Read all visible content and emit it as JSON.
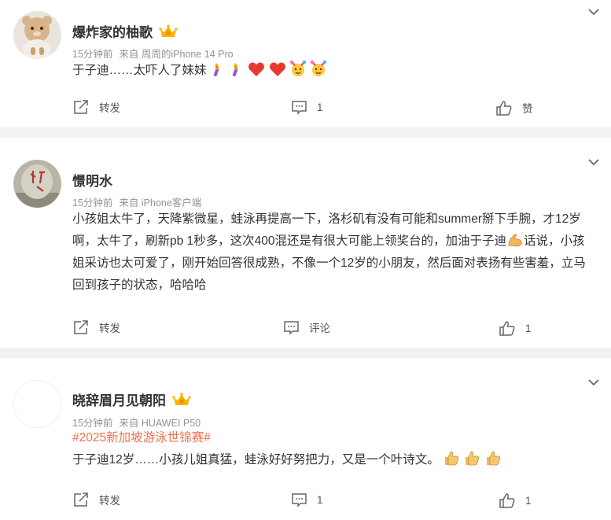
{
  "posts": [
    {
      "username": "爆炸家的柚歌",
      "time": "15分钟前",
      "source": "来自 周周的iPhone 14 Pro",
      "text": "于子迪……太吓人了妹妹",
      "emoji_trail": [
        "torch-icon",
        "torch-icon",
        "heart-icon",
        "heart-icon",
        "cheer-icon",
        "cheer-icon"
      ],
      "repost_label": "转发",
      "comment_label": "1",
      "like_label": "赞",
      "has_vip_badge": true
    },
    {
      "username": "憬明水",
      "time": "15分钟前",
      "source": "来自 iPhone客户端",
      "text_part1": "小孩姐太牛了，天降紫微星，蛙泳再提高一下，洛杉矶有没有可能和summer掰下手腕，才12岁啊，太牛了，刷新pb 1秒多，这次400混还是有很大可能上领奖台的，加油于子迪",
      "text_part2": "话说，小孩姐采访也太可爱了，刚开始回答很成熟，不像一个12岁的小朋友，然后面对表扬有些害羞，立马回到孩子的状态，哈哈哈",
      "repost_label": "转发",
      "comment_label": "评论",
      "like_label": "1",
      "has_vip_badge": false
    },
    {
      "username": "晓辞眉月见朝阳",
      "time": "15分钟前",
      "source": "来自 HUAWEI P50",
      "hashtag": "#2025新加坡游泳世锦赛#",
      "text": "于子迪12岁……小孩儿姐真猛，蛙泳好好努把力，又是一个叶诗文。",
      "emoji_trail": [
        "thumbs-up-icon",
        "thumbs-up-icon",
        "thumbs-up-icon"
      ],
      "repost_label": "转发",
      "comment_label": "1",
      "like_label": "1",
      "has_vip_badge": true
    }
  ],
  "colors": {
    "tag": "#eb7350",
    "separator": "#f2f2f2",
    "meta": "#939393",
    "heart": "#e8392f"
  }
}
